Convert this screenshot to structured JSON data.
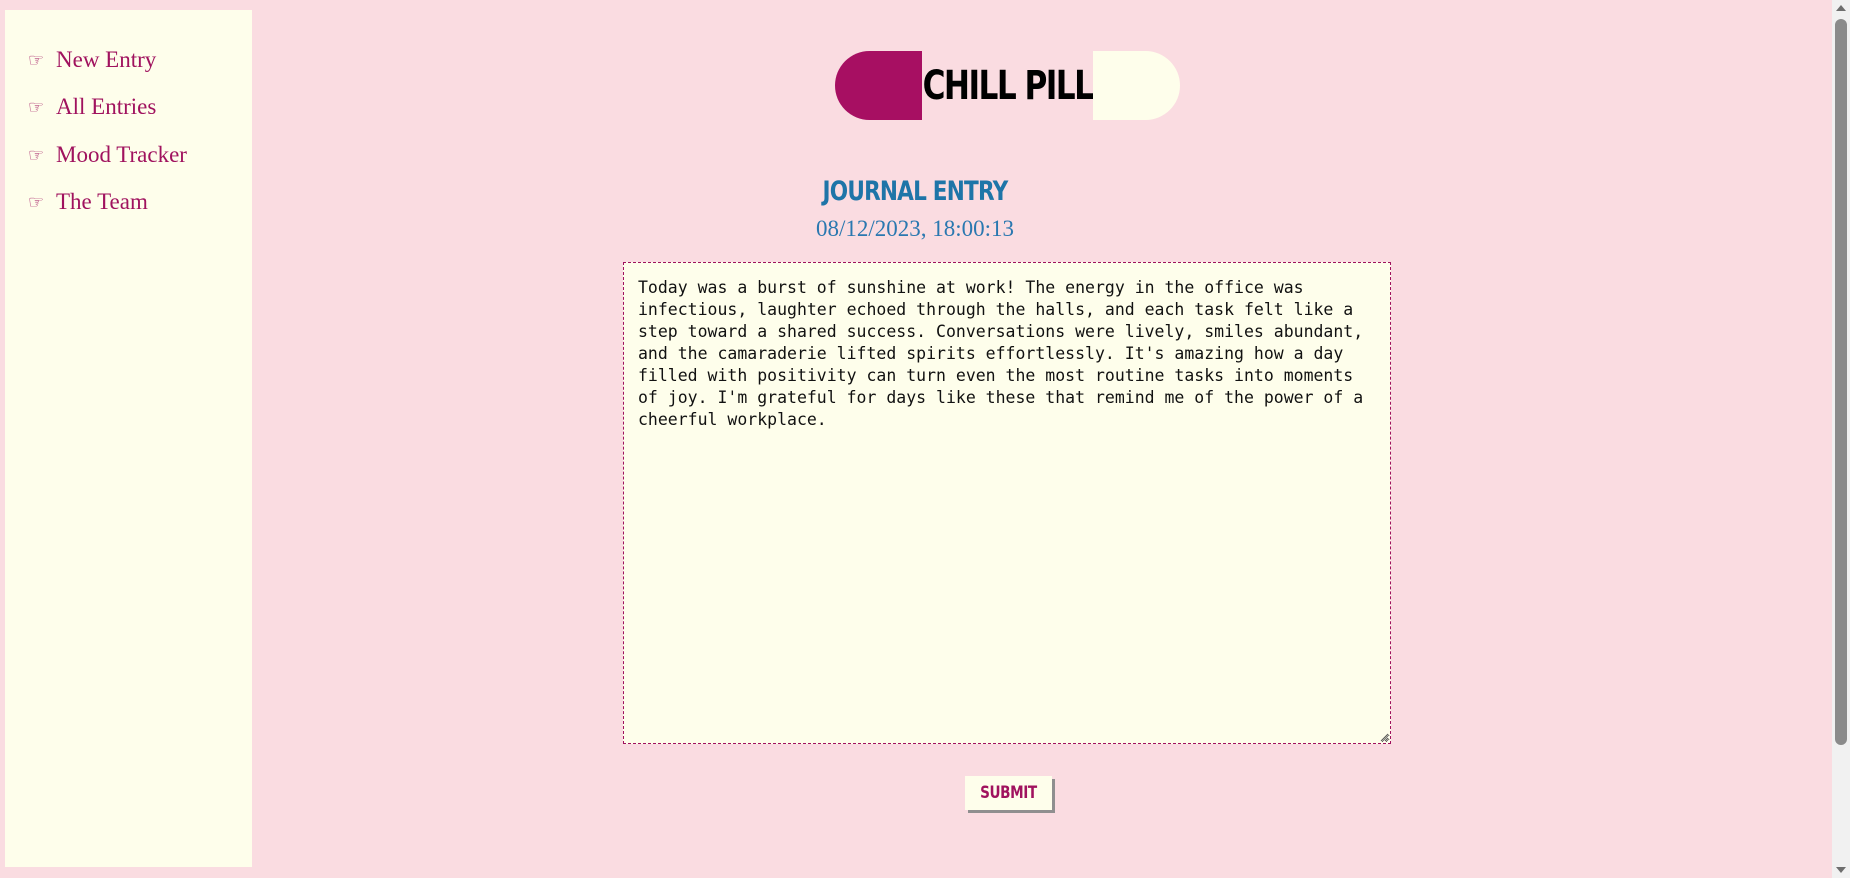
{
  "sidebar": {
    "items": [
      {
        "icon": "pointing-hand-icon",
        "glyph": "☞",
        "label": "New Entry"
      },
      {
        "icon": "pointing-hand-icon",
        "glyph": "☞",
        "label": "All Entries"
      },
      {
        "icon": "pointing-hand-icon",
        "glyph": "☞",
        "label": "Mood Tracker"
      },
      {
        "icon": "pointing-hand-icon",
        "glyph": "☞",
        "label": "The Team"
      }
    ]
  },
  "header": {
    "logo_text": "CHILL PILL"
  },
  "entry": {
    "title": "JOURNAL ENTRY",
    "timestamp": "08/12/2023, 18:00:13",
    "text": "Today was a burst of sunshine at work! The energy in the office was infectious, laughter echoed through the halls, and each task felt like a step toward a shared success. Conversations were lively, smiles abundant, and the camaraderie lifted spirits effortlessly. It's amazing how a day filled with positivity can turn even the most routine tasks into moments of joy. I'm grateful for days like these that remind me of the power of a cheerful workplace.",
    "submit_label": "SUBMIT"
  },
  "colors": {
    "background": "#fadce1",
    "panel": "#fefeeb",
    "accent": "#a0125e",
    "heading_blue": "#1e75a8"
  }
}
